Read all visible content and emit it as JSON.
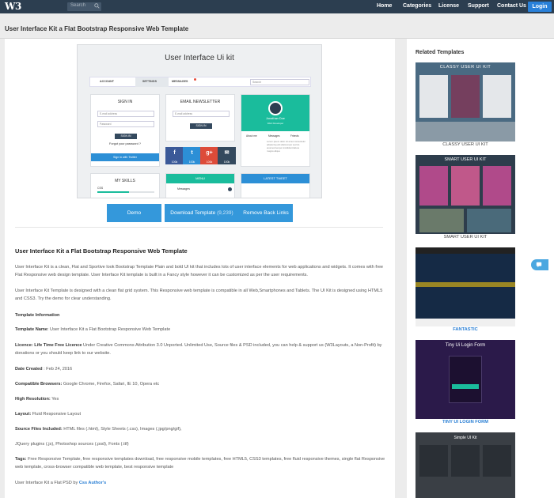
{
  "nav": {
    "logo": "W3",
    "search_placeholder": "Search",
    "links": [
      "Home",
      "Categories",
      "License",
      "Support",
      "Contact Us"
    ],
    "login": "Login"
  },
  "page": {
    "title": "User Interface Kit a Flat Bootstrap Responsive Web Template"
  },
  "preview": {
    "title": "User Interface Ui kit",
    "tabs": [
      "ACCOUNT",
      "SETTINGS",
      "MESSAGES"
    ],
    "search": "Search",
    "signin": {
      "heading": "SIGN IN",
      "email": "E-mail address",
      "password": "Password",
      "button": "SIGN IN",
      "forgot": "Forgot your password ?",
      "twitter": "Sign in with Twitter"
    },
    "newsletter": {
      "heading": "EMAIL NEWSLETTER",
      "email": "E-mail address",
      "button": "SIGN IN"
    },
    "profile": {
      "name": "Jonathan Doe",
      "role": "Web Developer",
      "tabs": [
        "About me",
        "Messages",
        "Friends"
      ],
      "bio": "Lorem ipsum dolor sit amet consectetur adipiscing elit ullamcorper sed do eiusmod tempor incididunt labore magna aliqua"
    },
    "social": [
      "f",
      "t",
      "g+",
      "✉"
    ],
    "social_counts": [
      "100k",
      "100k",
      "100k",
      "100k"
    ],
    "skills": {
      "heading": "MY SKILLS",
      "first": "CSS"
    },
    "menu": {
      "heading": "MENU",
      "first": "Messages"
    },
    "tweet": {
      "heading": "LATEST TWEET"
    }
  },
  "actions": {
    "demo": "Demo",
    "download": "Download Template",
    "download_count": "(9,239)",
    "remove": "Remove Back Links"
  },
  "description": {
    "title": "User Interface Kit a Flat Bootstrap Responsive Web Template",
    "p1": "User Interface Kit is a clean, Flat and Sportive look Bootstrap Template Plain and bold UI kit that includes lots of user interface elements for web applications and widgets. It comes with free Flat Responsive web design template. User Interface Kit template is built in a Fancy style however it can be customized as per the user requirements.",
    "p2": "User Interface Kit Template is designed with a clean flat grid system. This Responsive web template is compatible in all Web,Smartphones and Tablets. The UI Kit is designed using HTML5 and CSS3. Try the demo for clear understanding.",
    "info_heading": "Template Information",
    "name_label": "Template Name",
    "name_value": ": User Interface Kit a Flat Bootstrap Responsive Web Template",
    "licence_label": "Licence",
    "licence_type": ": Life Time Free Licence",
    "licence_value": " Under Creative Commons Attribution 3.0 Unported. Unlimited Use, Source files & PSD included, you can help & support us (W3Layouts, a Non-Profit) by donations or you should keep link to our website.",
    "date_label": "Date Created",
    "date_value": " : Feb 24, 2016",
    "browsers_label": "Compatible Browsers:",
    "browsers_value": " Google Chrome, Firefox, Safari, IE 10, Opera etc",
    "resolution_label": "High Resolution:",
    "resolution_value": " Yes",
    "layout_label": "Layout:",
    "layout_value": " Fluid Responsive Layout",
    "source_label": "Source Files Included:",
    "source_value": " HTML files (.html), Style Sheets (.css), Images (.jpg/png/gif),",
    "source_value2": "JQuery plugins (.js), Photoshop sources (.psd), Fonts (.ttf)",
    "tags_label": "Tags:",
    "tags_value": " Free Responsive Template, free responsive templates download, free responsive mobile templates, free HTML5, CSS3 templates, free fluid responsive themes, single flat Responsive web template, cross-browser compatible web template, best responsive template",
    "psd_text": "User Interface Kit a Flat PSD by ",
    "psd_link": "Css Author's"
  },
  "sidebar": {
    "title": "Related Templates",
    "templates": [
      {
        "label": "CLASSY USER UI KIT",
        "heading": "CLASSY USER UI KIT",
        "bg": "#4a6a82"
      },
      {
        "label": "SMART USER UI KIT",
        "heading": "SMART USER UI KIT",
        "bg": "#2e3d4c"
      },
      {
        "label": "FANTASTIC",
        "heading": "",
        "bg": "#1d3a5c"
      },
      {
        "label": "TINY UI LOGIN FORM",
        "heading": "Tiny Ui Login Form",
        "bg": "#2b1a4a"
      },
      {
        "label": "",
        "heading": "Simple UI Kit",
        "bg": "#3a3f45"
      }
    ]
  },
  "colors": {
    "navbar": "#2c3e50",
    "primary": "#3498db",
    "teal": "#1abc9c",
    "facebook": "#3b5998",
    "twitter": "#2c8fd6",
    "google": "#dd4b39",
    "mail": "#34495e"
  }
}
